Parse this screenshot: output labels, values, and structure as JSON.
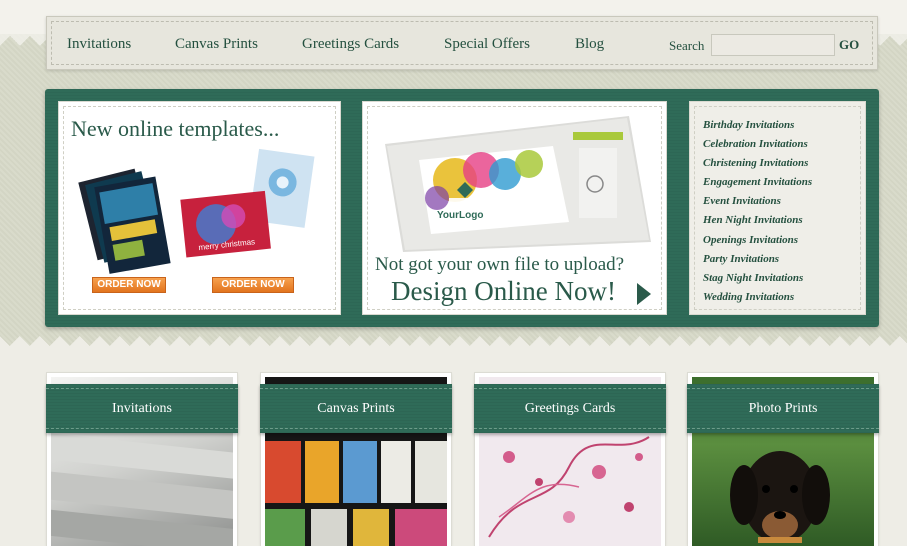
{
  "nav": {
    "links": [
      "Invitations",
      "Canvas Prints",
      "Greetings Cards",
      "Special Offers",
      "Blog"
    ],
    "search_label": "Search",
    "search_value": "",
    "go_label": "GO"
  },
  "feature": {
    "templates_title": "New online templates...",
    "order_now": "ORDER NOW",
    "card_caption": "merry christmas",
    "logo_text": "YourLogo",
    "design_sub": "Not got your own file to upload?",
    "design_main": "Design Online Now!"
  },
  "invitation_links": [
    "Birthday Invitations",
    "Celebration Invitations",
    "Christening Invitations",
    "Engagement Invitations",
    "Event Invitations",
    "Hen Night Invitations",
    "Openings Invitations",
    "Party Invitations",
    "Stag Night Invitations",
    "Wedding Invitations"
  ],
  "tiles": [
    "Invitations",
    "Canvas Prints",
    "Greetings Cards",
    "Photo Prints"
  ],
  "colors": {
    "brand_green": "#2f6b58",
    "text_green": "#24503f",
    "order_orange": "#e2741e",
    "background_beige": "#d7d9c8"
  }
}
